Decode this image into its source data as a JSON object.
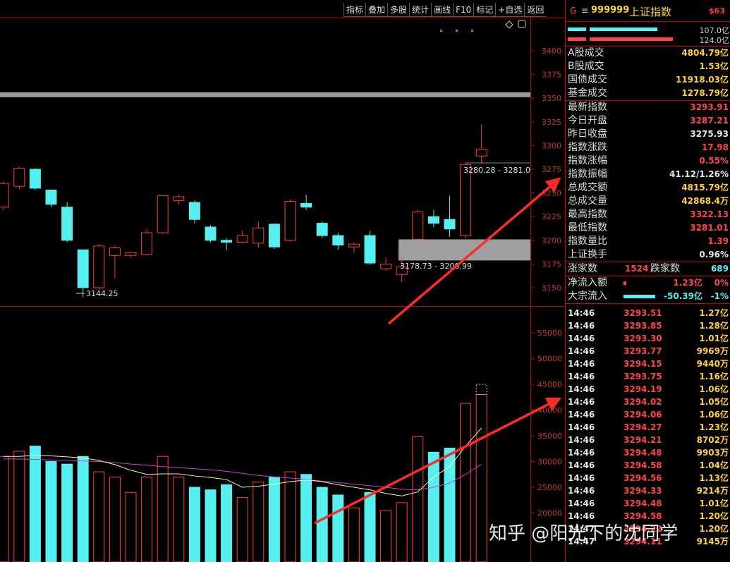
{
  "toolbar": {
    "items": [
      "指标",
      "叠加",
      "多股",
      "统计",
      "画线",
      "F10",
      "标记",
      "+自选",
      "返回"
    ]
  },
  "price_axis": [
    "3400",
    "3375",
    "3350",
    "3325",
    "3300",
    "3275",
    "3250",
    "3225",
    "3200",
    "3175",
    "3150"
  ],
  "volume_axis": [
    "55000",
    "50000",
    "45000",
    "40000",
    "35000",
    "30000",
    "25000",
    "20000"
  ],
  "annotations": {
    "low_label": "3144.25",
    "gap_label": "3178.73 - 3200.99",
    "top_label": "3280.28 - 3281.0"
  },
  "panel": {
    "g_mark": "G",
    "menu_icon": "≡",
    "code": "999999",
    "name": "上证指数",
    "tag": "$63",
    "bar_values": [
      "107.0亿",
      "124.0亿"
    ],
    "turnover": [
      {
        "label": "A股成交",
        "value": "4804.79亿"
      },
      {
        "label": "B股成交",
        "value": "1.53亿"
      },
      {
        "label": "国债成交",
        "value": "11918.03亿"
      },
      {
        "label": "基金成交",
        "value": "1278.79亿"
      }
    ],
    "stats": [
      {
        "label": "最新指数",
        "value": "3293.91",
        "color": "red"
      },
      {
        "label": "今日开盘",
        "value": "3287.21",
        "color": "red"
      },
      {
        "label": "昨日收盘",
        "value": "3275.93",
        "color": "white"
      },
      {
        "label": "指数涨跌",
        "value": "17.98",
        "color": "red"
      },
      {
        "label": "指数涨幅",
        "value": "0.55%",
        "color": "red"
      },
      {
        "label": "指数振幅",
        "value": "41.12/1.26%",
        "color": "white"
      },
      {
        "label": "总成交额",
        "value": "4815.79亿",
        "color": "yellow"
      },
      {
        "label": "总成交量",
        "value": "42868.4万",
        "color": "yellow"
      },
      {
        "label": "最高指数",
        "value": "3322.13",
        "color": "red"
      },
      {
        "label": "最低指数",
        "value": "3281.01",
        "color": "red"
      },
      {
        "label": "指数量比",
        "value": "1.39",
        "color": "red"
      },
      {
        "label": "上证换手",
        "value": "0.96%",
        "color": "white"
      }
    ],
    "breadth": {
      "up_label": "涨家数",
      "up": "1524",
      "down_label": "跌家数",
      "down": "689"
    },
    "flows": [
      {
        "label": "净流入额",
        "value": "1.23亿",
        "pct": "0%",
        "color": "red",
        "bar_color": "#ff4646",
        "bar_fraction": 0.05
      },
      {
        "label": "大宗流入",
        "value": "-50.39亿",
        "pct": "-1%",
        "color": "cyan",
        "bar_color": "#56f0f0",
        "bar_fraction": 0.6
      }
    ],
    "ticks": [
      {
        "time": "14:46",
        "price": "3293.51",
        "vol": "1.27亿"
      },
      {
        "time": "14:46",
        "price": "3293.85",
        "vol": "1.28亿"
      },
      {
        "time": "14:46",
        "price": "3293.30",
        "vol": "1.01亿"
      },
      {
        "time": "14:46",
        "price": "3293.77",
        "vol": "9969万"
      },
      {
        "time": "14:46",
        "price": "3294.15",
        "vol": "9440万"
      },
      {
        "time": "14:46",
        "price": "3293.75",
        "vol": "1.16亿"
      },
      {
        "time": "14:46",
        "price": "3294.19",
        "vol": "1.06亿"
      },
      {
        "time": "14:46",
        "price": "3294.02",
        "vol": "1.05亿"
      },
      {
        "time": "14:46",
        "price": "3294.06",
        "vol": "1.06亿"
      },
      {
        "time": "14:46",
        "price": "3294.27",
        "vol": "1.23亿"
      },
      {
        "time": "14:46",
        "price": "3294.21",
        "vol": "8702万"
      },
      {
        "time": "14:46",
        "price": "3294.48",
        "vol": "9903万"
      },
      {
        "time": "14:46",
        "price": "3294.58",
        "vol": "1.04亿"
      },
      {
        "time": "14:46",
        "price": "3294.56",
        "vol": "1.13亿"
      },
      {
        "time": "14:46",
        "price": "3294.33",
        "vol": "9214万"
      },
      {
        "time": "14:46",
        "price": "3294.48",
        "vol": "1.01亿"
      },
      {
        "time": "14:46",
        "price": "3294.58",
        "vol": "1.20亿"
      },
      {
        "time": "14:47",
        "price": "3294.22",
        "vol": "1.20亿"
      },
      {
        "time": "14:47",
        "price": "3294.11",
        "vol": "9145万"
      }
    ]
  },
  "watermark": "知乎 @阳光下的沈同学",
  "colors": {
    "up": "#ff3b3b",
    "down": "#56f0f0",
    "axis": "#c00000",
    "ma5": "#f5f5a0",
    "ma10": "#d23cd2"
  },
  "chart_data": {
    "type": "candlestick",
    "price_range": [
      3140,
      3410
    ],
    "volume_range": [
      0,
      59000
    ],
    "candles": [
      {
        "o": 3235,
        "h": 3262,
        "l": 3232,
        "c": 3260
      },
      {
        "o": 3257,
        "h": 3278,
        "l": 3254,
        "c": 3276
      },
      {
        "o": 3275,
        "h": 3276,
        "l": 3253,
        "c": 3255
      },
      {
        "o": 3253,
        "h": 3253,
        "l": 3235,
        "c": 3238
      },
      {
        "o": 3235,
        "h": 3240,
        "l": 3198,
        "c": 3200
      },
      {
        "o": 3190,
        "h": 3190,
        "l": 3144.25,
        "c": 3150
      },
      {
        "o": 3150,
        "h": 3196,
        "l": 3148,
        "c": 3194
      },
      {
        "o": 3184,
        "h": 3194,
        "l": 3160,
        "c": 3192
      },
      {
        "o": 3184,
        "h": 3185,
        "l": 3182,
        "c": 3187
      },
      {
        "o": 3185,
        "h": 3212,
        "l": 3184,
        "c": 3208
      },
      {
        "o": 3208,
        "h": 3247,
        "l": 3207,
        "c": 3247
      },
      {
        "o": 3242,
        "h": 3248,
        "l": 3238,
        "c": 3246
      },
      {
        "o": 3240,
        "h": 3242,
        "l": 3218,
        "c": 3222
      },
      {
        "o": 3214,
        "h": 3216,
        "l": 3198,
        "c": 3200
      },
      {
        "o": 3200,
        "h": 3202,
        "l": 3190,
        "c": 3198
      },
      {
        "o": 3198,
        "h": 3210,
        "l": 3197,
        "c": 3205
      },
      {
        "o": 3197,
        "h": 3220,
        "l": 3192,
        "c": 3213
      },
      {
        "o": 3217,
        "h": 3218,
        "l": 3191,
        "c": 3193
      },
      {
        "o": 3200,
        "h": 3243,
        "l": 3199,
        "c": 3241
      },
      {
        "o": 3239,
        "h": 3248,
        "l": 3232,
        "c": 3235
      },
      {
        "o": 3218,
        "h": 3220,
        "l": 3202,
        "c": 3205
      },
      {
        "o": 3205,
        "h": 3208,
        "l": 3190,
        "c": 3195
      },
      {
        "o": 3193,
        "h": 3198,
        "l": 3187,
        "c": 3196
      },
      {
        "o": 3205,
        "h": 3210,
        "l": 3174,
        "c": 3176
      },
      {
        "o": 3170,
        "h": 3182,
        "l": 3168,
        "c": 3175
      },
      {
        "o": 3164,
        "h": 3182,
        "l": 3156,
        "c": 3172
      },
      {
        "o": 3201,
        "h": 3232,
        "l": 3200,
        "c": 3230
      },
      {
        "o": 3225,
        "h": 3232,
        "l": 3214,
        "c": 3218
      },
      {
        "o": 3222,
        "h": 3247,
        "l": 3204,
        "c": 3212
      },
      {
        "o": 3205,
        "h": 3282,
        "l": 3202,
        "c": 3280
      },
      {
        "o": 3289,
        "h": 3322,
        "l": 3281,
        "c": 3296
      }
    ],
    "volumes": [
      31000,
      32000,
      33000,
      30000,
      29500,
      31000,
      28000,
      27000,
      24000,
      27000,
      31000,
      27000,
      25000,
      24500,
      25500,
      23000,
      26000,
      27000,
      28000,
      27500,
      25000,
      23500,
      21000,
      24000,
      20500,
      22000,
      34800,
      31800,
      32600,
      41300,
      43000
    ],
    "ma5": [
      31000,
      31000,
      31200,
      31100,
      30900,
      30700,
      30200,
      29400,
      28300,
      27500,
      27600,
      27600,
      27200,
      26900,
      26500,
      25000,
      25200,
      25600,
      26100,
      26400,
      26100,
      25500,
      25000,
      24500,
      23800,
      23300,
      24100,
      27000,
      29000,
      33000,
      36500
    ],
    "ma10": [
      30500,
      30500,
      30400,
      30300,
      30200,
      30100,
      30000,
      29800,
      29500,
      29300,
      29000,
      28800,
      28600,
      28400,
      28100,
      27700,
      27300,
      27000,
      26800,
      26500,
      26200,
      25900,
      25600,
      25300,
      25000,
      24600,
      24500,
      25000,
      25800,
      27500,
      29500
    ],
    "gap_zone": [
      3178.73,
      3200.99
    ],
    "resistance_line": 3354
  }
}
